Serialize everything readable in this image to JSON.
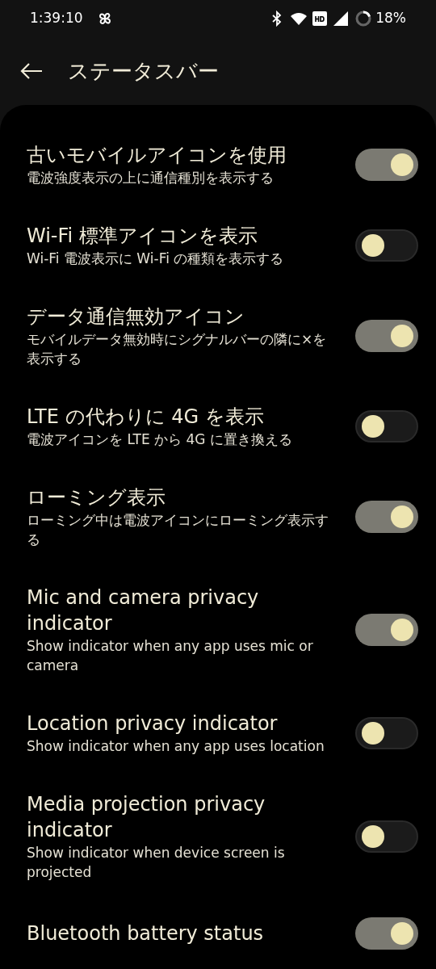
{
  "status_bar": {
    "time": "1:39:10",
    "battery": "18%"
  },
  "header": {
    "title": "ステータスバー"
  },
  "settings": [
    {
      "title": "古いモバイルアイコンを使用",
      "subtitle": "電波強度表示の上に通信種別を表示する",
      "on": true
    },
    {
      "title": "Wi-Fi 標準アイコンを表示",
      "subtitle": "Wi-Fi 電波表示に Wi-Fi の種類を表示する",
      "on": false
    },
    {
      "title": "データ通信無効アイコン",
      "subtitle": "モバイルデータ無効時にシグナルバーの隣に×を表示する",
      "on": true
    },
    {
      "title": "LTE の代わりに 4G を表示",
      "subtitle": "電波アイコンを LTE から 4G に置き換える",
      "on": false
    },
    {
      "title": "ローミング表示",
      "subtitle": "ローミング中は電波アイコンにローミング表示する",
      "on": true
    },
    {
      "title": "Mic and camera privacy indicator",
      "subtitle": "Show indicator when any app uses mic or camera",
      "on": true
    },
    {
      "title": "Location privacy indicator",
      "subtitle": "Show indicator when any app uses location",
      "on": false
    },
    {
      "title": "Media projection privacy indicator",
      "subtitle": "Show indicator when device screen is projected",
      "on": false
    },
    {
      "title": "Bluetooth battery status",
      "on": true
    }
  ]
}
